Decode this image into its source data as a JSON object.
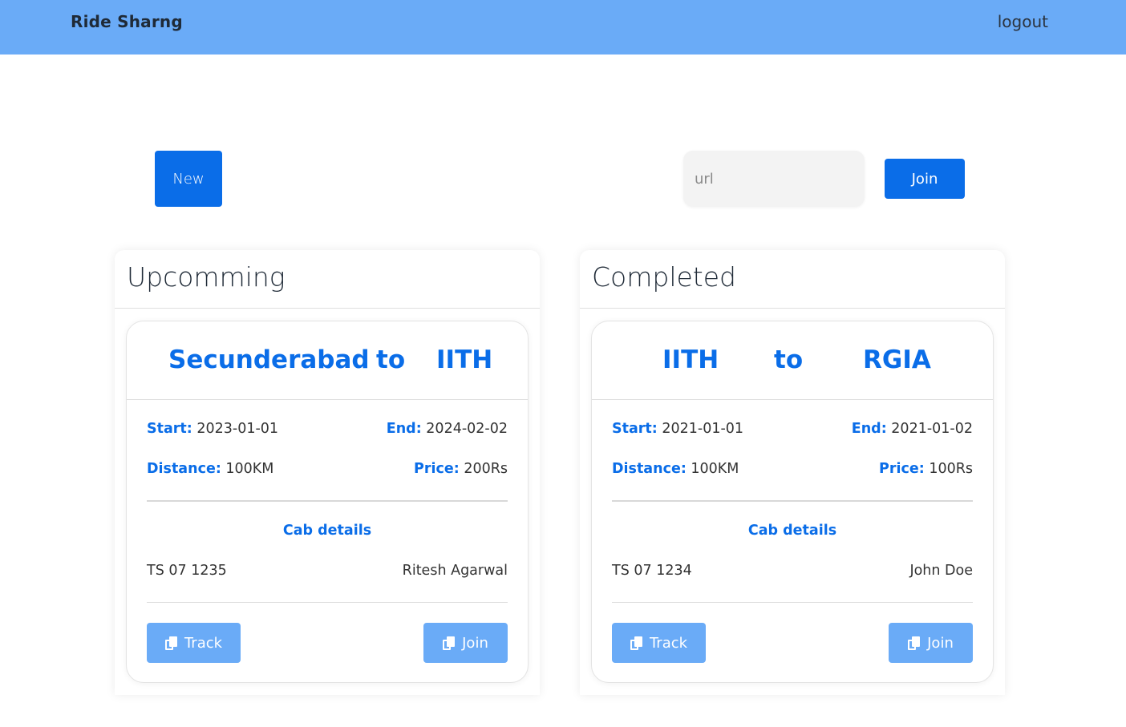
{
  "header": {
    "brand": "Ride Sharng",
    "logout_label": "logout"
  },
  "actions": {
    "new_label": "New",
    "url_placeholder": "url",
    "url_value": "",
    "join_label": "Join"
  },
  "colors": {
    "navbar": "#6aabf7",
    "primary": "#0a6de8",
    "secondary_button": "#6aabf7"
  },
  "panels": [
    {
      "title": "Upcomming",
      "ride": {
        "from": "Secunderabad",
        "to_word": "to",
        "to": "IITH",
        "start_label": "Start:",
        "start": "2023-01-01",
        "end_label": "End:",
        "end": "2024-02-02",
        "distance_label": "Distance:",
        "distance": "100KM",
        "price_label": "Price:",
        "price": "200Rs",
        "cab_title": "Cab details",
        "cab_number": "TS 07 1235",
        "driver": "Ritesh Agarwal",
        "track_label": "Track",
        "join_label": "Join",
        "button_icon": "copy-icon"
      }
    },
    {
      "title": "Completed",
      "ride": {
        "from": "IITH",
        "to_word": "to",
        "to": "RGIA",
        "start_label": "Start:",
        "start": "2021-01-01",
        "end_label": "End:",
        "end": "2021-01-02",
        "distance_label": "Distance:",
        "distance": "100KM",
        "price_label": "Price:",
        "price": "100Rs",
        "cab_title": "Cab details",
        "cab_number": "TS 07 1234",
        "driver": "John Doe",
        "track_label": "Track",
        "join_label": "Join",
        "button_icon": "copy-icon"
      }
    }
  ]
}
